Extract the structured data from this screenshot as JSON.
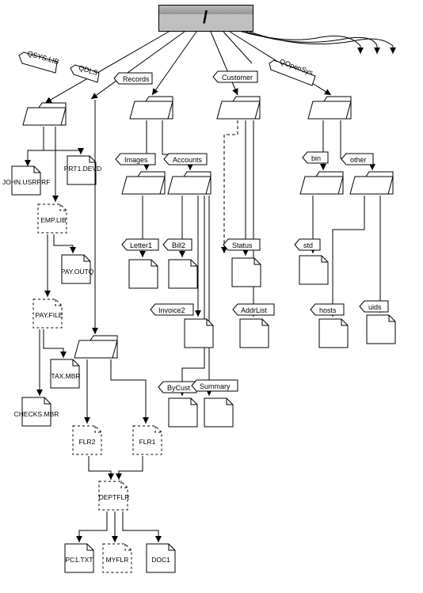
{
  "root": {
    "label": "/"
  },
  "tags": {
    "qsyslib": "QSYS.LIB",
    "qdls": "QDLS",
    "records": "Records",
    "customer": "Customer",
    "qopensys": "QOpenSys",
    "images": "Images",
    "accounts": "Accounts",
    "bin": "bin",
    "other": "other",
    "letter1": "Letter1",
    "bill2": "Bill2",
    "status": "Status",
    "std": "std",
    "invoice2": "Invoice2",
    "addrlist": "AddrList",
    "hosts": "hosts",
    "uids": "uids",
    "bycust": "ByCust",
    "summary": "Summary"
  },
  "files": {
    "john_usrprf": "JOHN.USRPRF",
    "prt1_devd": "PRT1.DEVD",
    "emp_lib": "EMP.LIB",
    "pay_outq": "PAY.OUTQ",
    "pay_file": "PAY.FILE",
    "tax_mbr": "TAX.MBR",
    "checks_mbr": "CHECKS.MBR",
    "flr2": "FLR2",
    "flr1": "FLR1",
    "deptflr": "DEPTFLR",
    "pc1_txt": "PC1.TXT",
    "myflr": "MYFLR",
    "doc1": "DOC1"
  }
}
